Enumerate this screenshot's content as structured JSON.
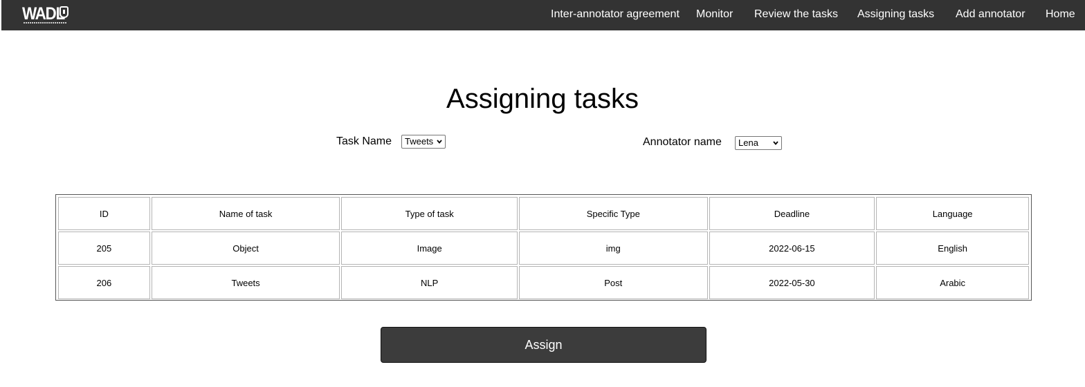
{
  "nav": {
    "logo": "WADL",
    "items": [
      {
        "label": "Inter-annotator agreement"
      },
      {
        "label": "Monitor"
      },
      {
        "label": "Review the tasks"
      },
      {
        "label": "Assigning tasks"
      },
      {
        "label": "Add annotator"
      },
      {
        "label": "Home"
      }
    ]
  },
  "page": {
    "title": "Assigning tasks"
  },
  "filters": {
    "task_label": "Task Name",
    "task_value": "Tweets",
    "annotator_label": "Annotator name",
    "annotator_value": "Lena"
  },
  "table": {
    "headers": [
      "ID",
      "Name of task",
      "Type of task",
      "Specific Type",
      "Deadline",
      "Language"
    ],
    "rows": [
      [
        "205",
        "Object",
        "Image",
        "img",
        "2022-06-15",
        "English"
      ],
      [
        "206",
        "Tweets",
        "NLP",
        "Post",
        "2022-05-30",
        "Arabic"
      ]
    ]
  },
  "actions": {
    "assign_label": "Assign"
  },
  "colors": {
    "navbar": "#333333",
    "button": "#3c3c3c"
  },
  "icons": {
    "logo": "wadl-logo",
    "select_arrow": "chevron-down-icon"
  }
}
